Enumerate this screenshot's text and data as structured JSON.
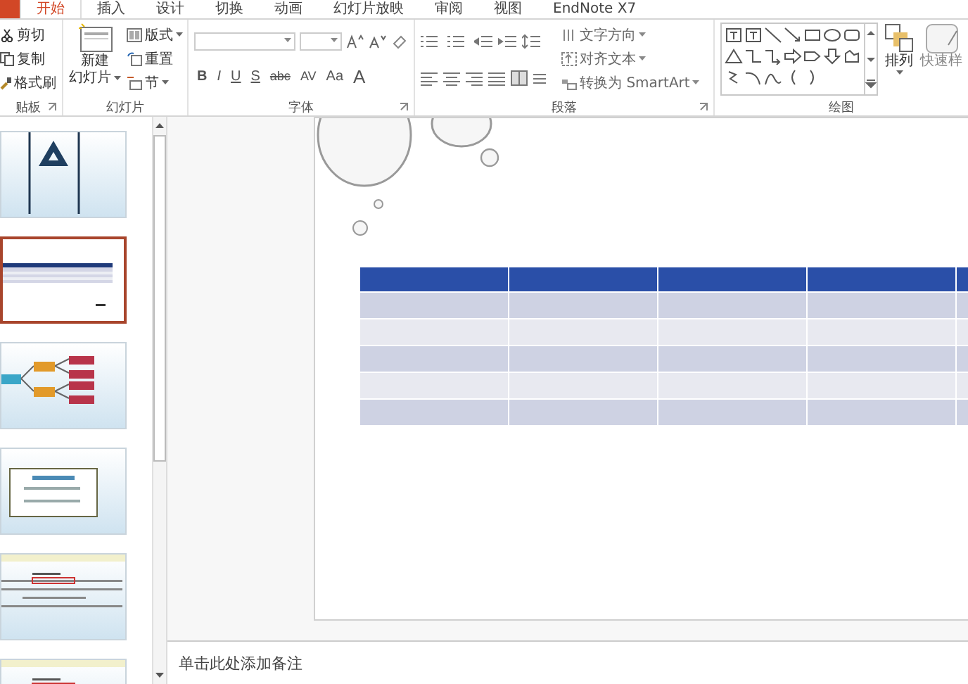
{
  "tabs": [
    {
      "label": "开始",
      "selected": true
    },
    {
      "label": "插入",
      "selected": false
    },
    {
      "label": "设计",
      "selected": false
    },
    {
      "label": "切换",
      "selected": false
    },
    {
      "label": "动画",
      "selected": false
    },
    {
      "label": "幻灯片放映",
      "selected": false
    },
    {
      "label": "审阅",
      "selected": false
    },
    {
      "label": "视图",
      "selected": false
    },
    {
      "label": "EndNote X7",
      "selected": false
    }
  ],
  "clipboard": {
    "label": "贴板",
    "commands": [
      {
        "kind": "cut",
        "label": "剪切"
      },
      {
        "kind": "copy",
        "label": "复制"
      },
      {
        "kind": "brush",
        "label": "格式刷"
      }
    ]
  },
  "slides_group": {
    "label": "幻灯片",
    "new_slide": [
      "新建",
      "幻灯片"
    ],
    "commands": [
      {
        "kind": "layout",
        "label": "版式"
      },
      {
        "kind": "reset",
        "label": "重置"
      },
      {
        "kind": "section",
        "label": "节"
      }
    ]
  },
  "font": {
    "label": "字体",
    "buttons": [
      "B",
      "I",
      "U",
      "S",
      "abc",
      "AV",
      "Aa",
      "A"
    ]
  },
  "paragraph": {
    "label": "段落",
    "commands": [
      {
        "kind": "direction",
        "label": "文字方向"
      },
      {
        "kind": "align",
        "label": "对齐文本"
      },
      {
        "kind": "smartart",
        "label": "转换为 SmartArt"
      }
    ]
  },
  "drawing": {
    "label": "绘图",
    "arrange": "排列",
    "quick_styles": "快速样"
  },
  "slides": [
    {
      "kind": "diagram",
      "selected": false
    },
    {
      "kind": "table",
      "selected": true
    },
    {
      "kind": "flowchart",
      "selected": false
    },
    {
      "kind": "textbox",
      "selected": false
    },
    {
      "kind": "text",
      "selected": false
    },
    {
      "kind": "text",
      "selected": false
    }
  ],
  "notes": {
    "placeholder": "单击此处添加备注"
  }
}
